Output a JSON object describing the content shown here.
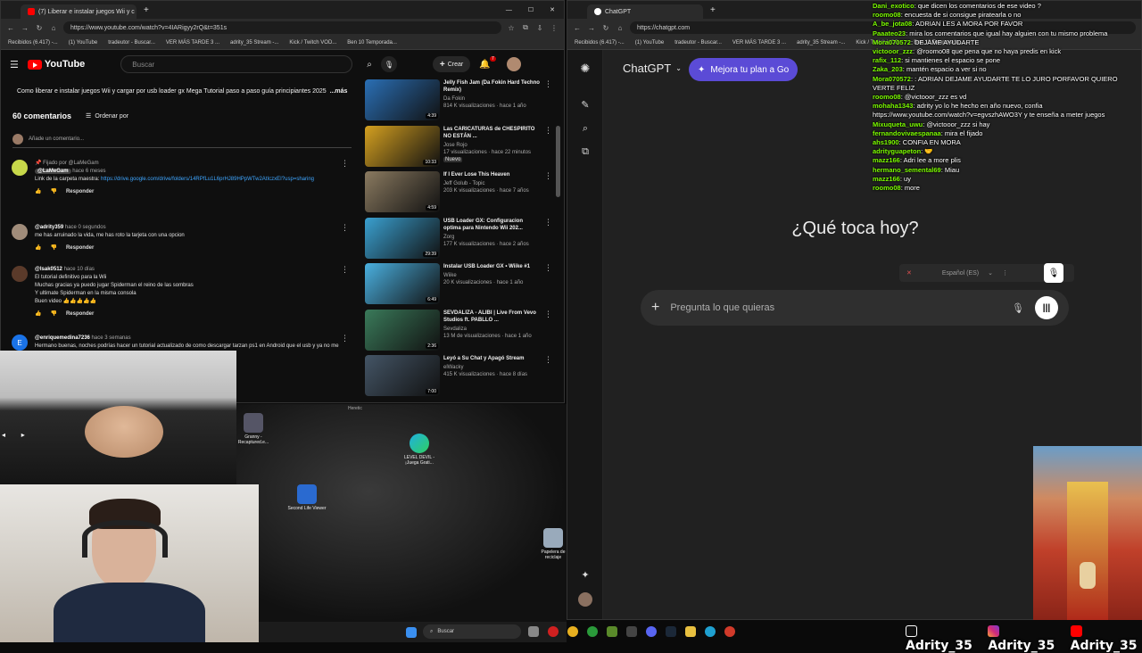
{
  "youtube_window": {
    "tab_title": "(7) Liberar e instalar juegos Wii y c",
    "url": "https://www.youtube.com/watch?v=4IARigyy2rQ&t=351s",
    "bookmarks": [
      "Recibidos (6.417) -...",
      "(1) YouTube",
      "tradeutor - Buscar...",
      "VER MÁS TARDE 3 ...",
      "adrity_35 Stream -...",
      "Kick / Twitch VOD...",
      "Ben 10 Temporada..."
    ],
    "logo": "YouTube",
    "search_placeholder": "Buscar",
    "create_label": "Crear",
    "notif_count": "7",
    "video_title": "Como liberar e instalar juegos Wii y cargar por usb loader gx Mega Tutorial paso a paso guía principiantes 2025",
    "more_label": "...más",
    "comments_count": "60 comentarios",
    "sort_label": "Ordenar por",
    "add_comment_placeholder": "Añade un comentario...",
    "reply_label": "Responder",
    "comments": [
      {
        "pinned": "Fijado por @LaMeGam",
        "author": "@LaMeGam",
        "time": "hace 6 meses",
        "text": "Link de la carpeta maestra: ",
        "link": "https://drive.google.com/drive/folders/14RPfLu1L6prHJ89HPpWTw2AtIczxEI?usp=sharing"
      },
      {
        "author": "@adrity359",
        "time": "hace 0 segundos",
        "text": "me has arruinado la vida, me has roto la tarjeta con una opcion"
      },
      {
        "author": "@lsak0512",
        "time": "hace 10 días",
        "text": "El tutorial definitivo para la Wii\nMuchas gracias ya puedo jugar Spiderman el reino de las sombras\nY ultimate Spiderman en la misma consola\nBuen video 👍👍👍👍👍"
      },
      {
        "author": "@enriquemedina7236",
        "time": "hace 3 semanas",
        "text": "Hermano buenas, noches podrías hacer un tutorial actualizado de como descargar tarzan ps1 en Android que el usb y ya no me sale ningun programa"
      }
    ],
    "recommended": [
      {
        "title": "Jelly Fish Jam (Da Fokin Hard Techno Remix)",
        "channel": "Da Fokin",
        "stats": "814 K visualizaciones · hace 1 año",
        "duration": "4:39",
        "color": "#2a6fb5"
      },
      {
        "title": "Las CARICATURAS de CHESPIRITO NO ESTÁN ...",
        "channel": "Jose Rojo",
        "stats": "17 visualizaciones · hace 22 minutos",
        "badge": "Nuevo",
        "duration": "10:33",
        "color": "#d4a020"
      },
      {
        "title": "If I Ever Lose This Heaven",
        "channel": "Jeff Golub - Topic",
        "stats": "203 K visualizaciones · hace 7 años",
        "duration": "4:59",
        "color": "#8a7a60"
      },
      {
        "title": "USB Loader GX: Configuracion optima para Nintendo Wii 202...",
        "channel": "Zorg",
        "stats": "177 K visualizaciones · hace 2 años",
        "duration": "29:39",
        "color": "#3aa0d0"
      },
      {
        "title": "Instalar USB Loader GX • Wiike #1",
        "channel": "Wiike",
        "stats": "20 K visualizaciones · hace 1 año",
        "duration": "6:49",
        "color": "#4ab0e0"
      },
      {
        "title": "SEVDALIZA - ALIBI | Live From Vevo Studios ft. PABLLO ...",
        "channel": "Sevdaliza",
        "stats": "13 M de visualizaciones · hace 1 año",
        "duration": "2:36",
        "color": "#3a7a5a"
      },
      {
        "title": "Leyó a Su Chat y Apagó Stream",
        "channel": "elWacky",
        "stats": "415 K visualizaciones · hace 8 días",
        "duration": "7:00",
        "color": "#445566"
      }
    ]
  },
  "chatgpt_window": {
    "tab_title": "ChatGPT",
    "url": "https://chatgpt.com",
    "model_label": "ChatGPT",
    "upgrade_label": "Mejora tu plan a Go",
    "heading": "¿Qué toca hoy?",
    "input_placeholder": "Pregunta lo que quieras",
    "language_label": "Español (ES)"
  },
  "stream_chat": [
    {
      "user": "Dani_exotico",
      "msg": "que dicen los comentarios de ese video ?"
    },
    {
      "user": "roomo08",
      "msg": "encuesta de si consigue piratearla o no"
    },
    {
      "user": "A_be_jota08",
      "msg": "ADRIAN LES A MORA POR FAVOR"
    },
    {
      "user": "Paaateo23",
      "msg": "mira los comentarios que igual hay alguien con tu mismo problema"
    },
    {
      "user": "Mora070572",
      "msg": "DEJAME AYUDARTE"
    },
    {
      "user": "victooor_zzz",
      "msg": "@roomo08 que pena que no haya predis en kick"
    },
    {
      "user": "rafix_112",
      "msg": "si mantienes el espacio se pone"
    },
    {
      "user": "Zaka_203",
      "msg": "mantén espacio a ver si no"
    },
    {
      "user": "Mora070572",
      "msg": ": ADRIAN DEJAME AYUDARTE TE LO JURO PORFAVOR QUIERO VERTE FELIZ"
    },
    {
      "user": "roomo08",
      "msg": "@victooor_zzz es vd"
    },
    {
      "user": "mohaha1343",
      "msg": "adrity yo lo he hecho en año nuevo, confia https://www.youtube.com/watch?v=egvszhAWO3Y y te enseña a meter juegos"
    },
    {
      "user": "Mixuqueta_uwu",
      "msg": "@victooor_zzz si hay"
    },
    {
      "user": "fernandovivaespanaa",
      "msg": "mira el fijado"
    },
    {
      "user": "ahs1900",
      "msg": "CONFIA EN MORA"
    },
    {
      "user": "adrityguapeton",
      "msg": "🤝"
    },
    {
      "user": "mazz166",
      "msg": "Adri lee a more plis"
    },
    {
      "user": "hermano_semental69",
      "msg": "Miau"
    },
    {
      "user": "mazz166",
      "msg": "uy"
    },
    {
      "user": "roomo08",
      "msg": "more"
    }
  ],
  "desktop": {
    "icons": [
      "Granny - Recaptured.e...",
      "LEVEL DEVIL - ¡Juega Grati...",
      "Second Life Viewer",
      "Papelera de reciclaje"
    ],
    "heretic_label": "Heretic",
    "taskbar_search": "Buscar"
  },
  "socials": [
    "Adrity_35",
    "Adrity_35",
    "Adrity_35"
  ],
  "colors": {
    "youtube_red": "#ff0000",
    "chat_user": "#7CFC00",
    "link_blue": "#3ea6ff",
    "upgrade_purple": "#5b4bd6"
  }
}
